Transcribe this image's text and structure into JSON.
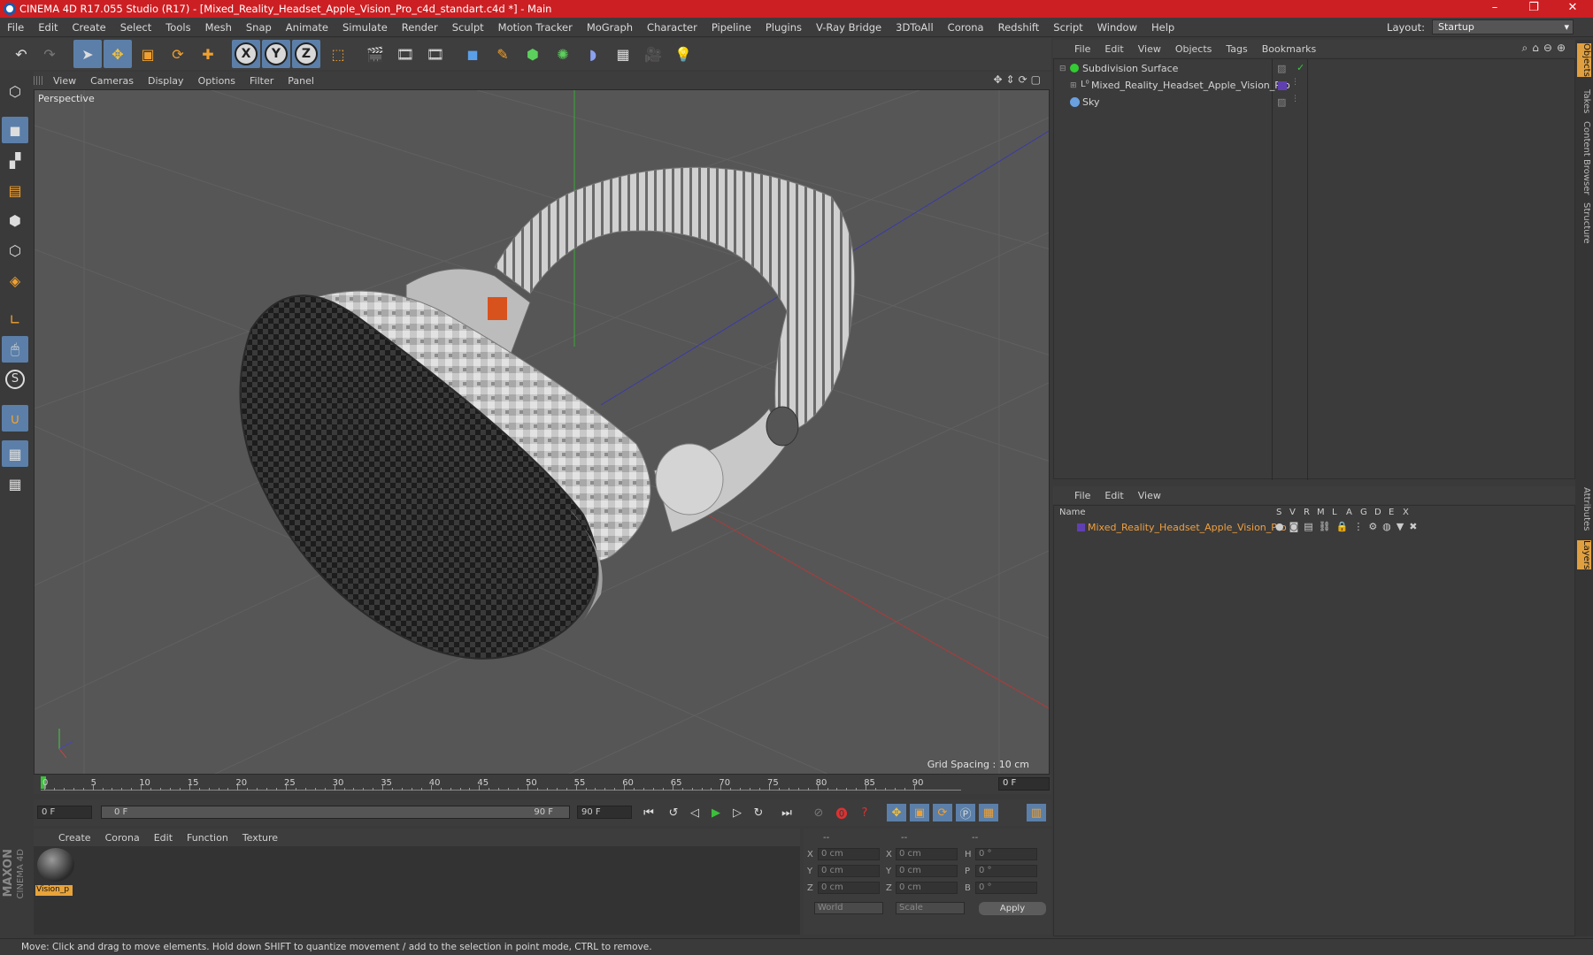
{
  "window": {
    "title": "CINEMA 4D R17.055 Studio (R17) - [Mixed_Reality_Headset_Apple_Vision_Pro_c4d_standart.c4d *] - Main",
    "minimize": "–",
    "restore": "❐",
    "close": "✕"
  },
  "menubar": {
    "items": [
      "File",
      "Edit",
      "Create",
      "Select",
      "Tools",
      "Mesh",
      "Snap",
      "Animate",
      "Simulate",
      "Render",
      "Sculpt",
      "Motion Tracker",
      "MoGraph",
      "Character",
      "Pipeline",
      "Plugins",
      "V-Ray Bridge",
      "3DToAll",
      "Corona",
      "Redshift",
      "Script",
      "Window",
      "Help"
    ],
    "layout_label": "Layout:",
    "layout_value": "Startup"
  },
  "toolbar": {
    "axis_x": "X",
    "axis_y": "Y",
    "axis_z": "Z"
  },
  "viewport": {
    "menu": [
      "View",
      "Cameras",
      "Display",
      "Options",
      "Filter",
      "Panel"
    ],
    "label": "Perspective",
    "grid_spacing": "Grid Spacing : 10 cm"
  },
  "timeline": {
    "ticks": [
      "0",
      "5",
      "10",
      "15",
      "20",
      "25",
      "30",
      "35",
      "40",
      "45",
      "50",
      "55",
      "60",
      "65",
      "70",
      "75",
      "80",
      "85",
      "90"
    ],
    "current_frame": "0 F"
  },
  "transport": {
    "start_frame": "0 F",
    "range_start": "0 F",
    "range_end": "90 F",
    "end_frame": "90 F"
  },
  "material_manager": {
    "menu": [
      "Create",
      "Corona",
      "Edit",
      "Function",
      "Texture"
    ],
    "material_name": "Vision_p"
  },
  "coordinates": {
    "headers": [
      "--",
      "--",
      "--"
    ],
    "rows": [
      {
        "a": "X",
        "av": "0 cm",
        "b": "X",
        "bv": "0 cm",
        "c": "H",
        "cv": "0 °"
      },
      {
        "a": "Y",
        "av": "0 cm",
        "b": "Y",
        "bv": "0 cm",
        "c": "P",
        "cv": "0 °"
      },
      {
        "a": "Z",
        "av": "0 cm",
        "b": "Z",
        "bv": "0 cm",
        "c": "B",
        "cv": "0 °"
      }
    ],
    "mode1": "World",
    "mode2": "Scale",
    "apply": "Apply"
  },
  "object_manager": {
    "menu": [
      "File",
      "Edit",
      "View",
      "Objects",
      "Tags",
      "Bookmarks"
    ],
    "objects": [
      {
        "name": "Subdivision Surface"
      },
      {
        "name": "Mixed_Reality_Headset_Apple_Vision_Pro"
      },
      {
        "name": "Sky"
      }
    ]
  },
  "layer_manager": {
    "menu": [
      "File",
      "Edit",
      "View"
    ],
    "columns": [
      "Name",
      "S",
      "V",
      "R",
      "M",
      "L",
      "A",
      "G",
      "D",
      "E",
      "X"
    ],
    "layer_name": "Mixed_Reality_Headset_Apple_Vision_Pro"
  },
  "right_tabs": [
    "Objects",
    "Takes",
    "Content Browser",
    "Structure",
    "Attributes",
    "Layers"
  ],
  "status": {
    "text": "Move: Click and drag to move elements. Hold down SHIFT to quantize movement / add to the selection in point mode, CTRL to remove."
  },
  "brand": {
    "maxon": "MAXON",
    "cinema": "CINEMA 4D"
  },
  "colors": {
    "titlebar": "#cc1f23",
    "accent_blue": "#5b7fa8",
    "layer_orange": "#f0a040"
  }
}
